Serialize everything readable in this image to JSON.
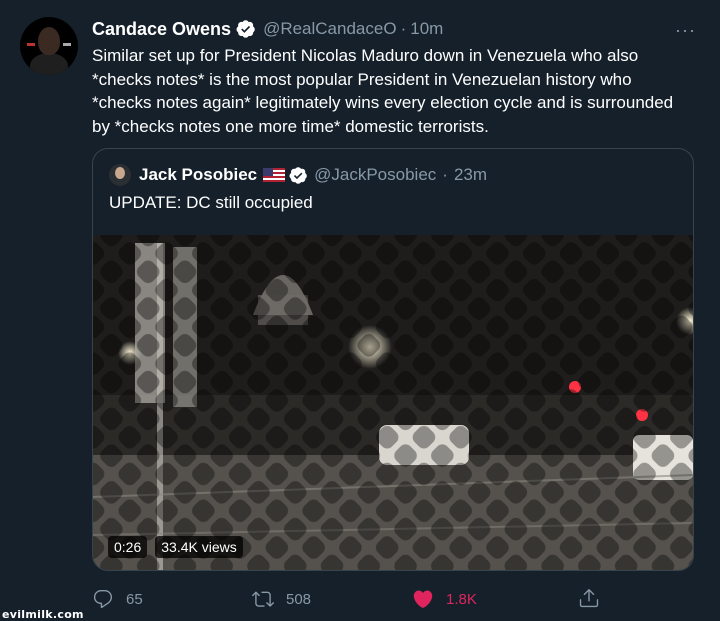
{
  "tweet": {
    "display_name": "Candace Owens",
    "handle": "@RealCandaceO",
    "separator": "·",
    "time": "10m",
    "more_icon": "···",
    "text": "Similar set up for President Nicolas Maduro down in Venezuela who also *checks notes* is the most popular President in Venezuelan history who *checks notes again* legitimately wins every election cycle and is surrounded by *checks notes one more time* domestic terrorists."
  },
  "quote": {
    "display_name": "Jack Posobiec",
    "handle": "@JackPosobiec",
    "separator": "·",
    "time": "23m",
    "text": "UPDATE: DC still occupied",
    "video": {
      "duration": "0:26",
      "views": "33.4K views"
    }
  },
  "actions": {
    "replies": "65",
    "retweets": "508",
    "likes": "1.8K"
  },
  "colors": {
    "background": "#15202b",
    "muted": "#8899a6",
    "border": "#38444d",
    "verified": "#ffffff",
    "like": "#e0245e"
  },
  "watermark": "evilmilk.com"
}
